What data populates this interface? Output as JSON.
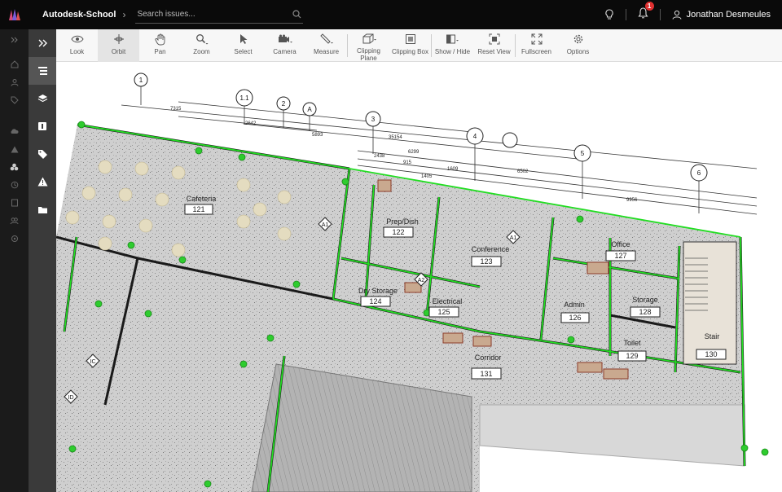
{
  "header": {
    "project": "Autodesk-School",
    "search_placeholder": "Search issues...",
    "notification_count": "1",
    "user_name": "Jonathan Desmeules"
  },
  "toolbar": {
    "tools": [
      {
        "label": "Look"
      },
      {
        "label": "Orbit"
      },
      {
        "label": "Pan"
      },
      {
        "label": "Zoom"
      },
      {
        "label": "Select"
      },
      {
        "label": "Camera"
      },
      {
        "label": "Measure"
      },
      {
        "label": "Clipping Plane"
      },
      {
        "label": "Clipping Box"
      },
      {
        "label": "Show / Hide"
      },
      {
        "label": "Reset View"
      },
      {
        "label": "Fullscreen"
      },
      {
        "label": "Options"
      }
    ]
  },
  "model": {
    "grid_labels": [
      "1",
      "1.1",
      "2",
      "A",
      "3",
      "4",
      "5",
      "6"
    ],
    "dimensions": [
      "7315",
      "2642",
      "5893",
      "35154",
      "2438",
      "6299",
      "6502",
      "9956",
      "1609",
      "1405",
      "915"
    ],
    "rooms": [
      {
        "name": "Cafeteria",
        "number": "121"
      },
      {
        "name": "Prep/Dish",
        "number": "122"
      },
      {
        "name": "Conference",
        "number": "123"
      },
      {
        "name": "Dry Storage",
        "number": "124"
      },
      {
        "name": "Electrical",
        "number": "125"
      },
      {
        "name": "Admin",
        "number": "126"
      },
      {
        "name": "Office",
        "number": "127"
      },
      {
        "name": "Storage",
        "number": "128"
      },
      {
        "name": "Toilet",
        "number": "129"
      },
      {
        "name": "Stair",
        "number": "130"
      },
      {
        "name": "Corridor",
        "number": "131"
      }
    ],
    "tags": [
      "A1",
      "A1",
      "A2",
      "ID",
      "IC"
    ]
  }
}
